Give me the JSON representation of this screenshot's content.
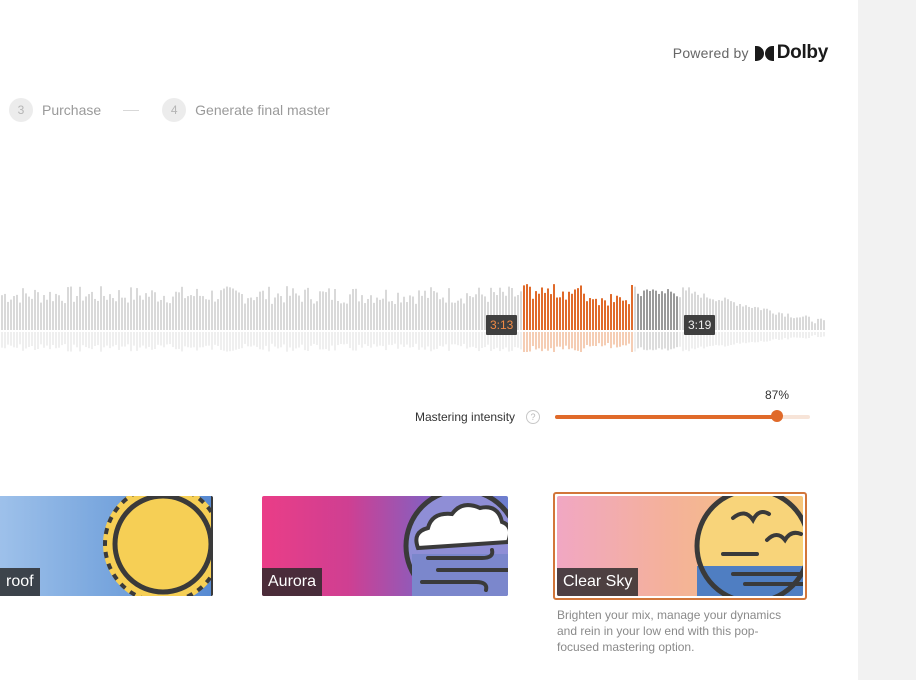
{
  "header": {
    "powered_by": "Powered by",
    "brand": "Dolby"
  },
  "steps": [
    {
      "num": "3",
      "label": "Purchase"
    },
    {
      "num": "4",
      "label": "Generate final master"
    }
  ],
  "waveform": {
    "selection_start": "3:13",
    "selection_end": "3:19"
  },
  "intensity": {
    "label": "Mastering intensity",
    "help": "?",
    "value_text": "87%",
    "value": 0.87
  },
  "presets": [
    {
      "title": "roof",
      "icon": "sun-icon",
      "selected": false
    },
    {
      "title": "Aurora",
      "icon": "cloud-wind-icon",
      "selected": false
    },
    {
      "title": "Clear Sky",
      "icon": "birds-sea-icon",
      "selected": true
    }
  ],
  "selected_preset": {
    "description": "Brighten your mix, manage your dynamics and rein in your low end with this pop-focused mastering option."
  },
  "colors": {
    "accent": "#e06a2a",
    "accent_light": "#f7e4d8",
    "outline": "#3a3a3a",
    "sun": "#f6cf55",
    "sea": "#4f7ec2"
  }
}
